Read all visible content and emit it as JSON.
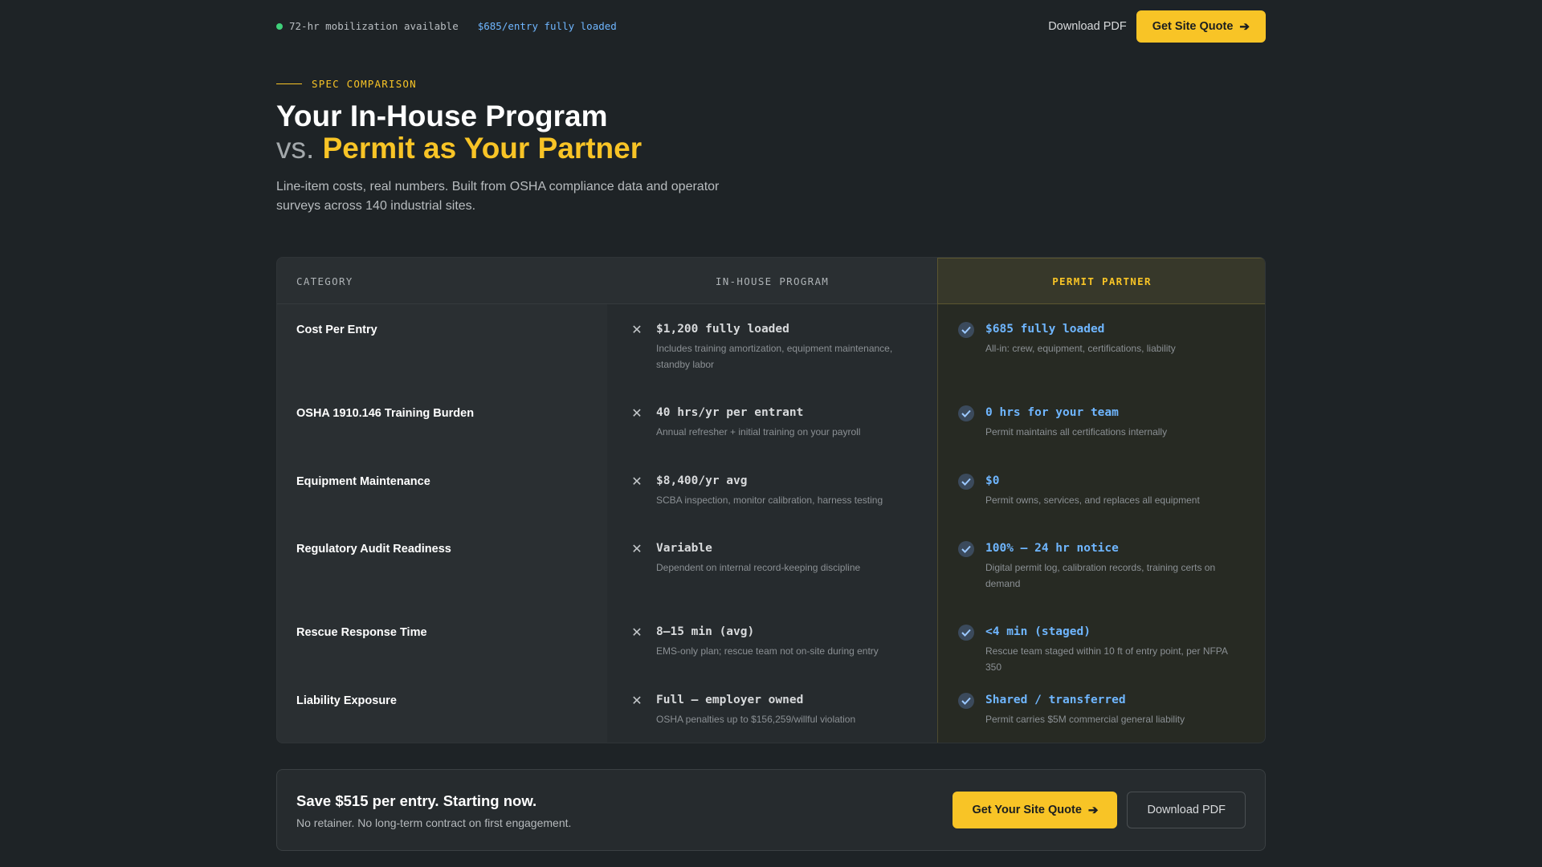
{
  "topbar": {
    "status_text": "72-hr mobilization available",
    "price_text": "$685/entry fully loaded",
    "download_pdf": "Download PDF",
    "quote_button": "Get Site Quote"
  },
  "hero": {
    "eyebrow": "SPEC COMPARISON",
    "title_line1": "Your In-House Program",
    "title_vs": "vs.",
    "title_accent": "Permit as Your Partner",
    "subtitle": "Line-item costs, real numbers. Built from OSHA compliance data and operator surveys across 140 industrial sites."
  },
  "table": {
    "headers": {
      "category": "CATEGORY",
      "in_house": "IN-HOUSE PROGRAM",
      "partner": "PERMIT PARTNER"
    },
    "rows": [
      {
        "category": "Cost Per Entry",
        "in_house_value": "$1,200 fully loaded",
        "in_house_note": "Includes training amortization, equipment maintenance, standby labor",
        "partner_value": "$685 fully loaded",
        "partner_note": "All-in: crew, equipment, certifications, liability"
      },
      {
        "category": "OSHA 1910.146 Training Burden",
        "in_house_value": "40 hrs/yr per entrant",
        "in_house_note": "Annual refresher + initial training on your payroll",
        "partner_value": "0 hrs for your team",
        "partner_note": "Permit maintains all certifications internally"
      },
      {
        "category": "Equipment Maintenance",
        "in_house_value": "$8,400/yr avg",
        "in_house_note": "SCBA inspection, monitor calibration, harness testing",
        "partner_value": "$0",
        "partner_note": "Permit owns, services, and replaces all equipment"
      },
      {
        "category": "Regulatory Audit Readiness",
        "in_house_value": "Variable",
        "in_house_note": "Dependent on internal record-keeping discipline",
        "partner_value": "100% — 24 hr notice",
        "partner_note": "Digital permit log, calibration records, training certs on demand"
      },
      {
        "category": "Rescue Response Time",
        "in_house_value": "8–15 min (avg)",
        "in_house_note": "EMS-only plan; rescue team not on-site during entry",
        "partner_value": "<4 min (staged)",
        "partner_note": "Rescue team staged within 10 ft of entry point, per NFPA 350"
      },
      {
        "category": "Liability Exposure",
        "in_house_value": "Full — employer owned",
        "in_house_note": "OSHA penalties up to $156,259/willful violation",
        "partner_value": "Shared / transferred",
        "partner_note": "Permit carries $5M commercial general liability"
      }
    ]
  },
  "cta": {
    "title": "Save $515 per entry. Starting now.",
    "subtitle": "No retainer. No long-term contract on first engagement.",
    "quote_button": "Get Your Site Quote",
    "download_pdf": "Download PDF"
  },
  "colors": {
    "accent": "#f8c426",
    "partner_value": "#6fb6ff",
    "status_dot": "#3fd07a",
    "background": "#1e2326"
  }
}
